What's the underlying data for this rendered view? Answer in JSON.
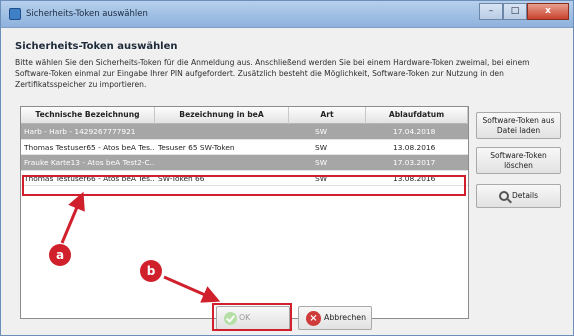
{
  "window": {
    "title": "Sicherheits-Token auswählen",
    "min_glyph": "–",
    "max_glyph": "□",
    "close_glyph": "x"
  },
  "heading": "Sicherheits-Token auswählen",
  "description": "Bitte wählen Sie den Sicherheits-Token für die Anmeldung aus. Anschließend werden Sie bei einem Hardware-Token zweimal, bei einem Software-Token einmal zur Eingabe Ihrer PIN aufgefordert. Zusätzlich besteht die Möglichkeit, Software-Token zur Nutzung in den Zertifikatsspeicher zu importieren.",
  "table": {
    "columns": [
      "Technische Bezeichnung",
      "Bezeichnung in beA",
      "Art",
      "Ablaufdatum"
    ],
    "rows": [
      {
        "tech": "Harb - Harb - 1429267777921",
        "bea": "",
        "art": "SW",
        "date": "17.04.2018",
        "style": "gray"
      },
      {
        "tech": "Thomas Testuser65 - Atos beA Tes...",
        "bea": "Tesuser 65 SW-Token",
        "art": "SW",
        "date": "13.08.2016",
        "style": "light"
      },
      {
        "tech": "Frauke Karte13 - Atos beA Test2-C...",
        "bea": "",
        "art": "SW",
        "date": "17.03.2017",
        "style": "gray"
      },
      {
        "tech": "Thomas Testuser66 - Atos beA Tes...",
        "bea": "SW-Token 66",
        "art": "SW",
        "date": "13.08.2016",
        "style": "selected"
      }
    ]
  },
  "side_buttons": {
    "load_line1": "Software-Token aus",
    "load_line2": "Datei laden",
    "delete_line1": "Software-Token",
    "delete_line2": "löschen",
    "details": "Details"
  },
  "bottom_buttons": {
    "ok": "OK",
    "cancel": "Abbrechen"
  },
  "markers": {
    "a": "a",
    "b": "b"
  },
  "colors": {
    "annotation_red": "#d0202b",
    "disabled_row_gray": "#a6a6a6"
  }
}
